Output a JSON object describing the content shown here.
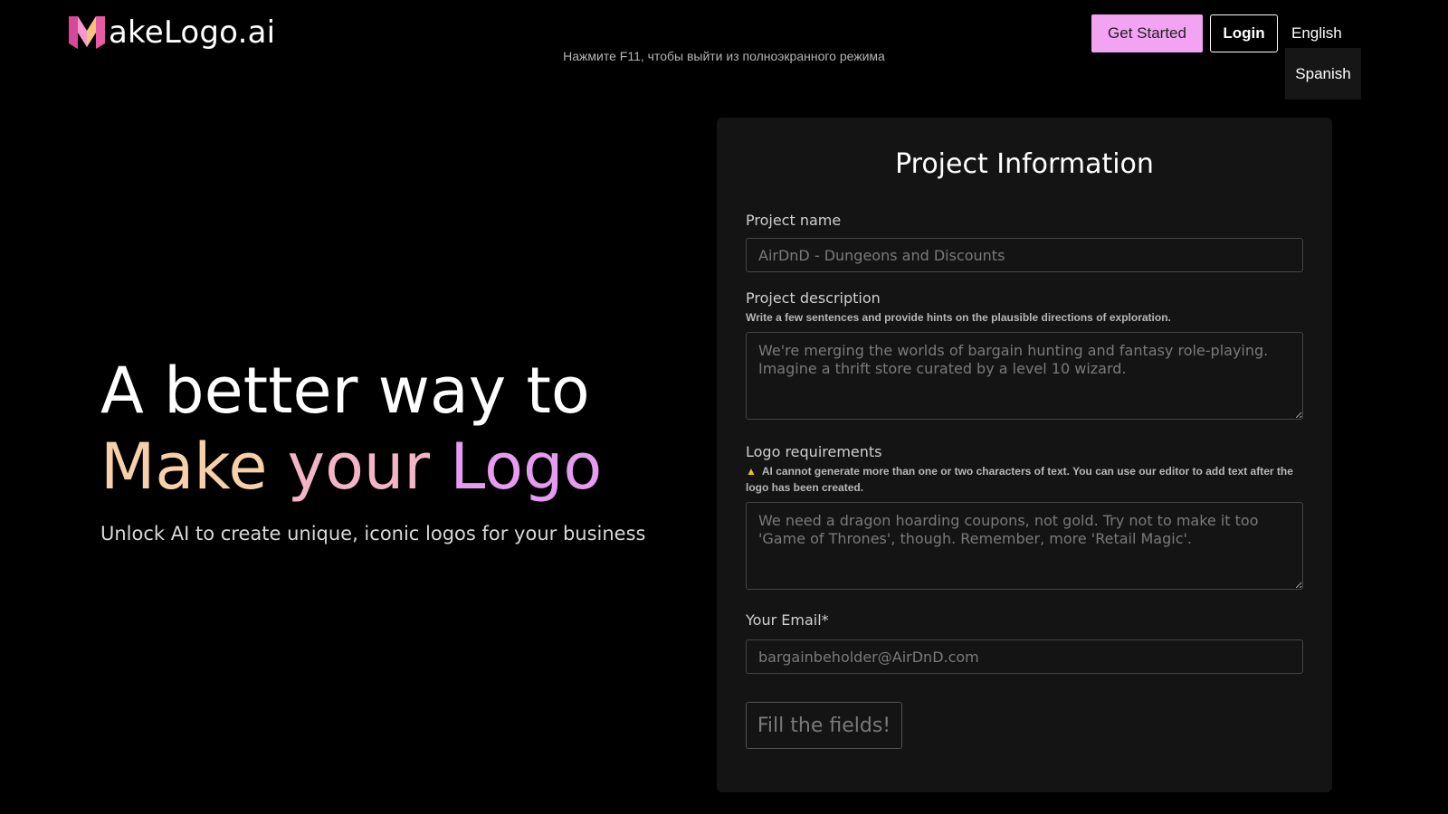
{
  "header": {
    "logo_text": "akeLogo.ai",
    "logo_letter": "M",
    "get_started_label": "Get Started",
    "login_label": "Login",
    "language_current": "English",
    "language_menu": [
      "Spanish"
    ]
  },
  "browser": {
    "fullscreen_hint": "Нажмите F11, чтобы выйти из полноэкранного режима"
  },
  "hero": {
    "line1": "A better way to",
    "line2_words": [
      "Make",
      "your",
      "Logo"
    ],
    "subtitle": "Unlock AI to create unique, iconic logos for your business"
  },
  "form": {
    "title": "Project Information",
    "project_name_label": "Project name",
    "project_name_placeholder": "AirDnD - Dungeons and Discounts",
    "project_name_value": "",
    "description_label": "Project description",
    "description_hint": "Write a few sentences and provide hints on the plausible directions of exploration.",
    "description_placeholder": "We're merging the worlds of bargain hunting and fantasy role-playing. Imagine a thrift store curated by a level 10 wizard.",
    "description_value": "",
    "requirements_label": "Logo requirements",
    "requirements_warning": "AI cannot generate more than one or two characters of text. You can use our editor to add text after the logo has been created.",
    "requirements_placeholder": "We need a dragon hoarding coupons, not gold. Try not to make it too 'Game of Thrones', though. Remember, more 'Retail Magic'.",
    "requirements_value": "",
    "email_label": "Your Email*",
    "email_placeholder": "bargainbeholder@AirDnD.com",
    "email_value": "",
    "submit_label": "Fill the fields!"
  },
  "colors": {
    "accent_pink": "#f2a3f2",
    "gradient_make": "#f7d0a9",
    "gradient_your": "#f3b4c6",
    "gradient_logo": "#e69af0",
    "card_bg": "#141414"
  }
}
